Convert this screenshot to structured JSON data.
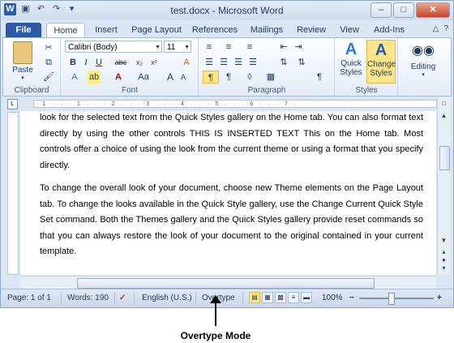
{
  "window": {
    "title": "test.docx - Microsoft Word"
  },
  "qat": {
    "icons": [
      "word-icon",
      "save-icon",
      "undo-icon",
      "redo-icon",
      "customize-icon"
    ]
  },
  "tabs": [
    {
      "label": "File"
    },
    {
      "label": "Home"
    },
    {
      "label": "Insert"
    },
    {
      "label": "Page Layout"
    },
    {
      "label": "References"
    },
    {
      "label": "Mailings"
    },
    {
      "label": "Review"
    },
    {
      "label": "View"
    },
    {
      "label": "Add-Ins"
    }
  ],
  "ribbon": {
    "clipboard": {
      "label": "Clipboard",
      "paste": "Paste"
    },
    "font": {
      "label": "Font",
      "font_name": "Calibri (Body)",
      "font_size": "11",
      "bold": "B",
      "italic": "I",
      "underline": "U",
      "strike": "abc",
      "sub": "x₂",
      "sup": "x²",
      "grow": "A",
      "shrink": "A",
      "case": "Aa",
      "clear": "A"
    },
    "paragraph": {
      "label": "Paragraph",
      "pilcrow": "¶"
    },
    "styles": {
      "label": "Styles",
      "quick_styles": "Quick Styles",
      "change_styles": "Change Styles"
    },
    "editing": {
      "label": "Editing"
    }
  },
  "document": {
    "paragraphs": [
      "look for the selected text from the Quick Styles gallery on the Home tab. You can also format text directly by using the other controls THIS IS INSERTED TEXT This on the Home tab. Most controls offer a choice of using the look from the current theme or using a format that you specify directly.",
      "To change the overall look of your document, choose new Theme elements on the Page Layout tab. To change the looks available in the Quick Style gallery, use the Change Current Quick Style Set command. Both the Themes gallery and the Quick Styles gallery provide reset commands so that you can always restore the look of your document to the original contained in your current template."
    ]
  },
  "ruler": {
    "marks": "· 1 · · · 1 · · · 2 · · · 3 · · · 4 · · · 5 · · · 6 · · · 7 ·"
  },
  "status": {
    "page": "Page: 1 of 1",
    "words": "Words: 190",
    "language": "English (U.S.)",
    "mode": "Overtype",
    "zoom": "100%"
  },
  "annotation": {
    "label": "Overtype Mode"
  }
}
